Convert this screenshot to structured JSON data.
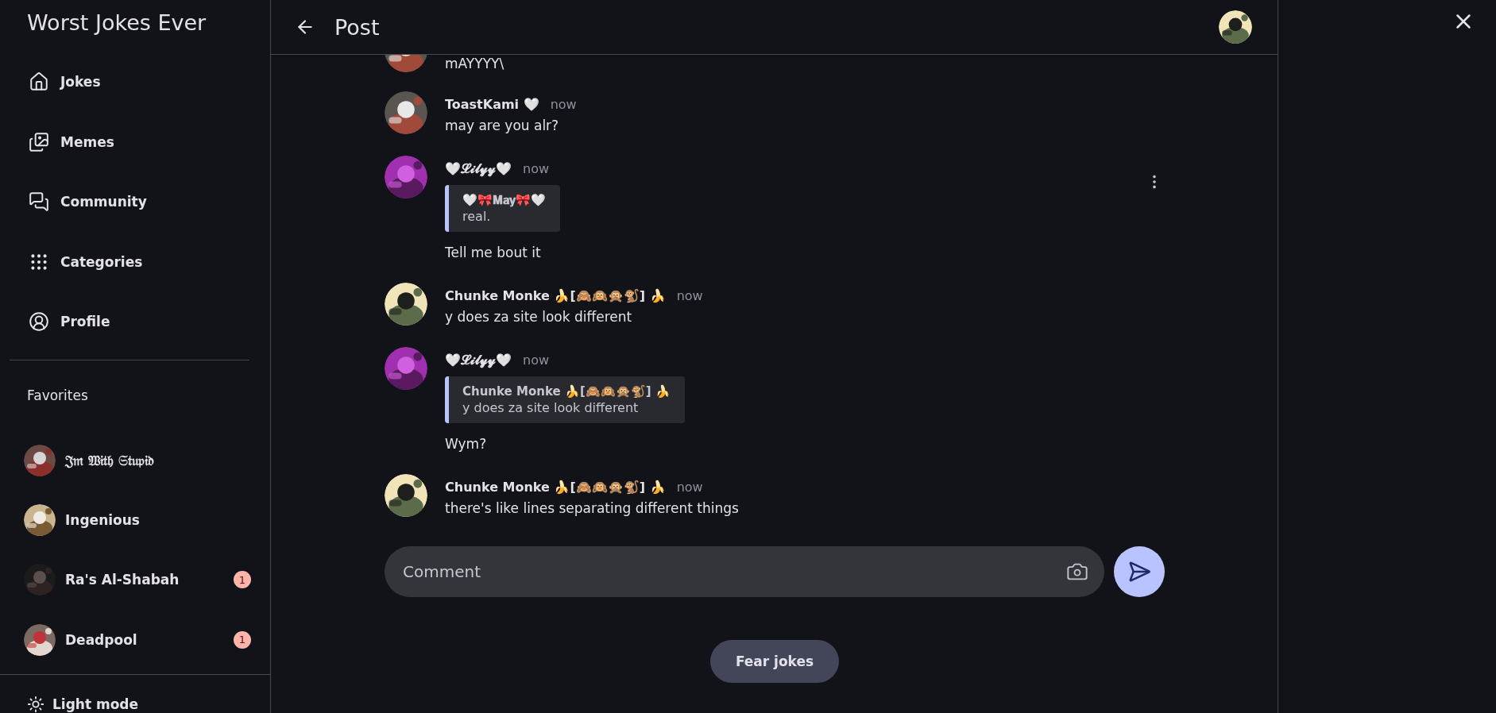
{
  "sidebar": {
    "title": "Worst Jokes Ever",
    "nav": [
      {
        "kind": "home",
        "label": "Jokes"
      },
      {
        "kind": "images",
        "label": "Memes"
      },
      {
        "kind": "forum",
        "label": "Community"
      },
      {
        "kind": "grid",
        "label": "Categories"
      },
      {
        "kind": "profile",
        "label": "Profile"
      }
    ],
    "favorites_heading": "Favorites",
    "favorites": [
      {
        "name": "𝔍𝔪 𝔚𝔦𝔱𝔥 𝔖𝔱𝔲𝔭𝔦𝔡"
      },
      {
        "name": "Ingenious"
      },
      {
        "name": "Ra's Al-Shabah",
        "badge": "1"
      },
      {
        "name": "Deadpool",
        "badge": "1"
      }
    ],
    "theme_toggle": "Light mode"
  },
  "header": {
    "title": "Post"
  },
  "comments": [
    {
      "kind": "cut",
      "body": "mAYYYY\\"
    },
    {
      "kind": "message",
      "author": "ToastKami 🤍",
      "time": "now",
      "body": "may are you alr?",
      "menu_visible": false
    },
    {
      "kind": "reply",
      "author": "🤍𝓛𝓲𝓵𝔂𝔂🤍",
      "time": "now",
      "quote": {
        "author": "🤍🎀𝐌𝐚𝐲🎀🤍",
        "body": "real."
      },
      "body": "Tell me bout it",
      "menu_visible": true
    },
    {
      "kind": "message",
      "author": "Chunke Monke 🍌[🙈🙉🙊🐒] 🍌",
      "time": "now",
      "body": "y does za site look different",
      "menu_visible": false
    },
    {
      "kind": "reply",
      "author": "🤍𝓛𝓲𝓵𝔂𝔂🤍",
      "time": "now",
      "quote": {
        "author": "Chunke Monke 🍌[🙈🙉🙊🐒] 🍌",
        "body": "y does za site look different"
      },
      "body": "Wym?",
      "menu_visible": false
    },
    {
      "kind": "message",
      "author": "Chunke Monke 🍌[🙈🙉🙊🐒] 🍌",
      "time": "now",
      "body": "there's like lines separating different things",
      "menu_visible": false
    }
  ],
  "composer": {
    "placeholder": "Comment"
  },
  "fab": {
    "label": "Fear jokes"
  }
}
